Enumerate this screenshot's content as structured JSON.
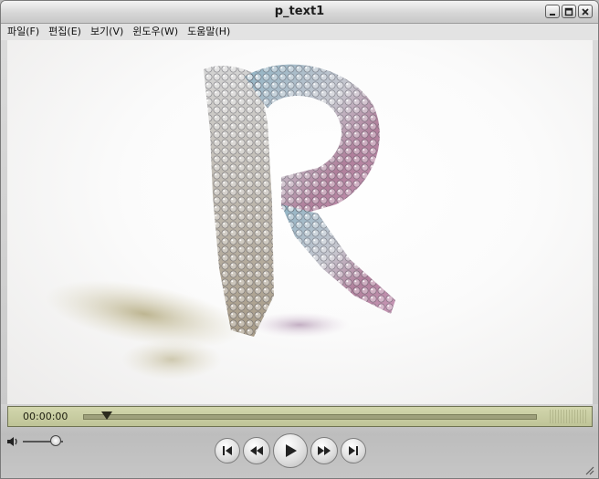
{
  "window": {
    "title": "p_text1"
  },
  "menu": [
    {
      "label": "파일(F)"
    },
    {
      "label": "편집(E)"
    },
    {
      "label": "보기(V)"
    },
    {
      "label": "윈도우(W)"
    },
    {
      "label": "도움말(H)"
    }
  ],
  "player": {
    "current_time": "00:00:00",
    "progress": 0.05,
    "volume": 0.8
  },
  "icons": {
    "minimize": "minimize-icon",
    "maximize": "maximize-icon",
    "close": "close-icon",
    "speaker": "speaker-icon",
    "skip_start": "skip-to-start-icon",
    "rewind": "rewind-icon",
    "play": "play-icon",
    "fast_forward": "fast-forward-icon",
    "skip_end": "skip-to-end-icon"
  }
}
